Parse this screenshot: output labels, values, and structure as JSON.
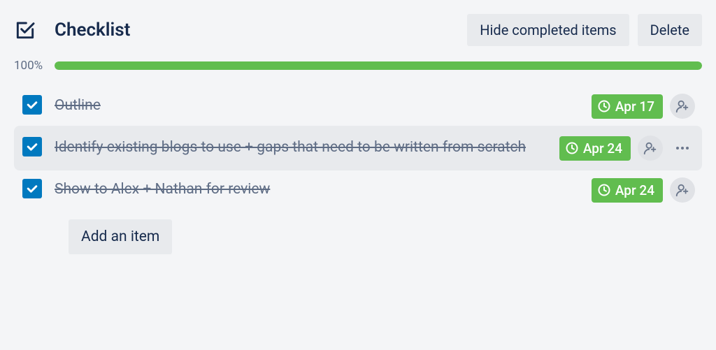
{
  "header": {
    "title": "Checklist",
    "hide_completed_label": "Hide completed items",
    "delete_label": "Delete"
  },
  "progress": {
    "percent_label": "100%",
    "percent_value": 100
  },
  "items": [
    {
      "text": "Outline",
      "checked": true,
      "due_date": "Apr 17",
      "hovered": false,
      "show_more": false
    },
    {
      "text": "Identify existing blogs to use + gaps that need to be written from scratch",
      "checked": true,
      "due_date": "Apr 24",
      "hovered": true,
      "show_more": true
    },
    {
      "text": "Show to Alex + Nathan for review",
      "checked": true,
      "due_date": "Apr 24",
      "hovered": false,
      "show_more": false
    }
  ],
  "add_item_label": "Add an item"
}
